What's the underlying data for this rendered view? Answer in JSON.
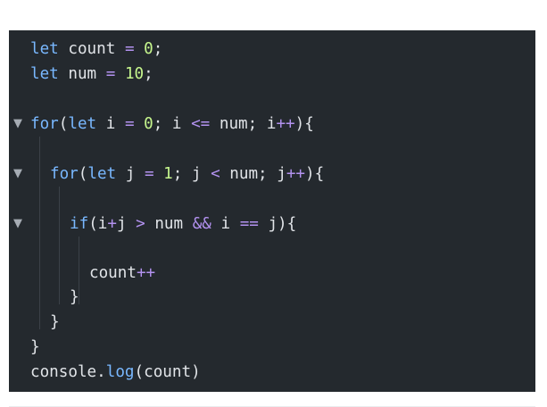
{
  "code": {
    "line1": {
      "kw": "let",
      "a": " count ",
      "op": "=",
      "b": " ",
      "num": "0",
      "c": ";"
    },
    "line2": {
      "kw": "let",
      "a": " num ",
      "op": "=",
      "b": " ",
      "num": "10",
      "c": ";"
    },
    "line4": {
      "kw1": "for",
      "p1": "(",
      "kw2": "let",
      "a": " i ",
      "op1": "=",
      "b": " ",
      "num": "0",
      "c": "; i ",
      "op2": "<=",
      "d": " num; i",
      "op3": "++",
      "e": "){"
    },
    "line6": {
      "kw1": "for",
      "p1": "(",
      "kw2": "let",
      "a": " j ",
      "op1": "=",
      "b": " ",
      "num": "1",
      "c": "; j ",
      "op2": "<",
      "d": " num; j",
      "op3": "++",
      "e": "){"
    },
    "line8": {
      "kw": "if",
      "a": "(i",
      "op1": "+",
      "b": "j ",
      "op2": ">",
      "c": " num ",
      "op3": "&&",
      "d": " i ",
      "op4": "==",
      "e": " j){"
    },
    "line10": {
      "a": "count",
      "op": "++"
    },
    "line11": {
      "a": "}"
    },
    "line12": {
      "a": "}"
    },
    "line13": {
      "a": "}"
    },
    "line14": {
      "a": "console",
      "dot": ".",
      "fn": "log",
      "b": "(count)"
    }
  },
  "fold_marker": "▼",
  "colors": {
    "background": "#24292e",
    "keyword": "#79b8ff",
    "number": "#c6f68d",
    "operator": "#b392f0",
    "text": "#e1e4e8"
  }
}
